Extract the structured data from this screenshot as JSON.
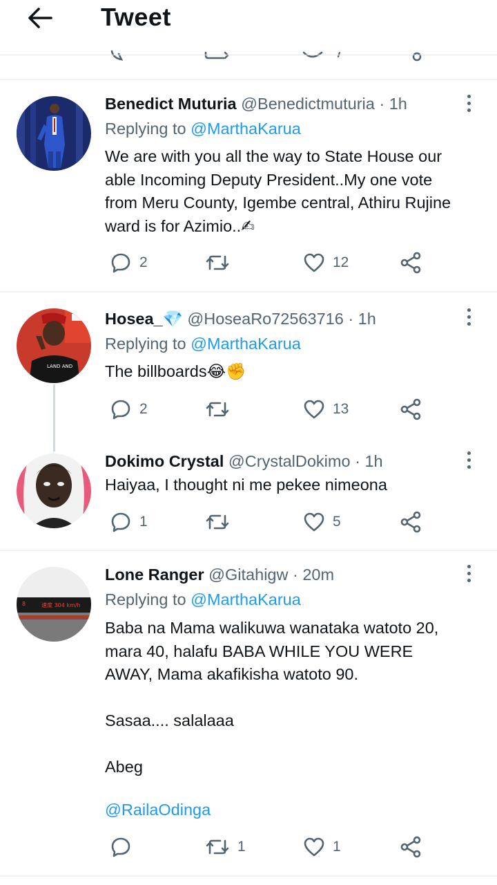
{
  "header": {
    "title": "Tweet",
    "back_icon": "arrow-left-icon"
  },
  "colors": {
    "accent": "#1d9bf0",
    "text_primary": "#0f1419",
    "text_secondary": "#536471",
    "divider": "#eff3f4"
  },
  "tweets": [
    {
      "name": "Benedict Muturia",
      "handle": "@Benedictmuturia",
      "time": "· 1h",
      "replying_prefix": "Replying to ",
      "replying_to": "@MarthaKarua",
      "body": "We are with you all the way to State House our\nable Incoming Deputy President..My one vote\nfrom Meru County, Igembe central, Athiru Rujine\nward is for Azimio..✍",
      "replies": "2",
      "retweets": "",
      "likes": "12"
    },
    {
      "name": "Hosea_💎",
      "handle": "@HoseaRo72563716",
      "time": "· 1h",
      "replying_prefix": "Replying to ",
      "replying_to": "@MarthaKarua",
      "body": "The billboards😂✊",
      "replies": "2",
      "retweets": "",
      "likes": "13"
    },
    {
      "name": "Dokimo Crystal",
      "handle": "@CrystalDokimo",
      "time": "· 1h",
      "body": "Haiyaa, I thought ni me pekee nimeona",
      "replies": "1",
      "retweets": "",
      "likes": "5"
    },
    {
      "name": "Lone Ranger",
      "handle": "@Gitahigw",
      "time": "· 20m",
      "replying_prefix": "Replying to ",
      "replying_to": "@MarthaKarua",
      "body": "Baba na Mama walikuwa wanataka watoto 20,\nmara 40, halafu BABA WHILE YOU WERE\nAWAY, Mama akafikisha watoto 90.\n\nSasaa.... salalaaa\n\nAbeg",
      "mention_line": "@RailaOdinga",
      "replies": "",
      "retweets": "1",
      "likes": "1"
    }
  ]
}
